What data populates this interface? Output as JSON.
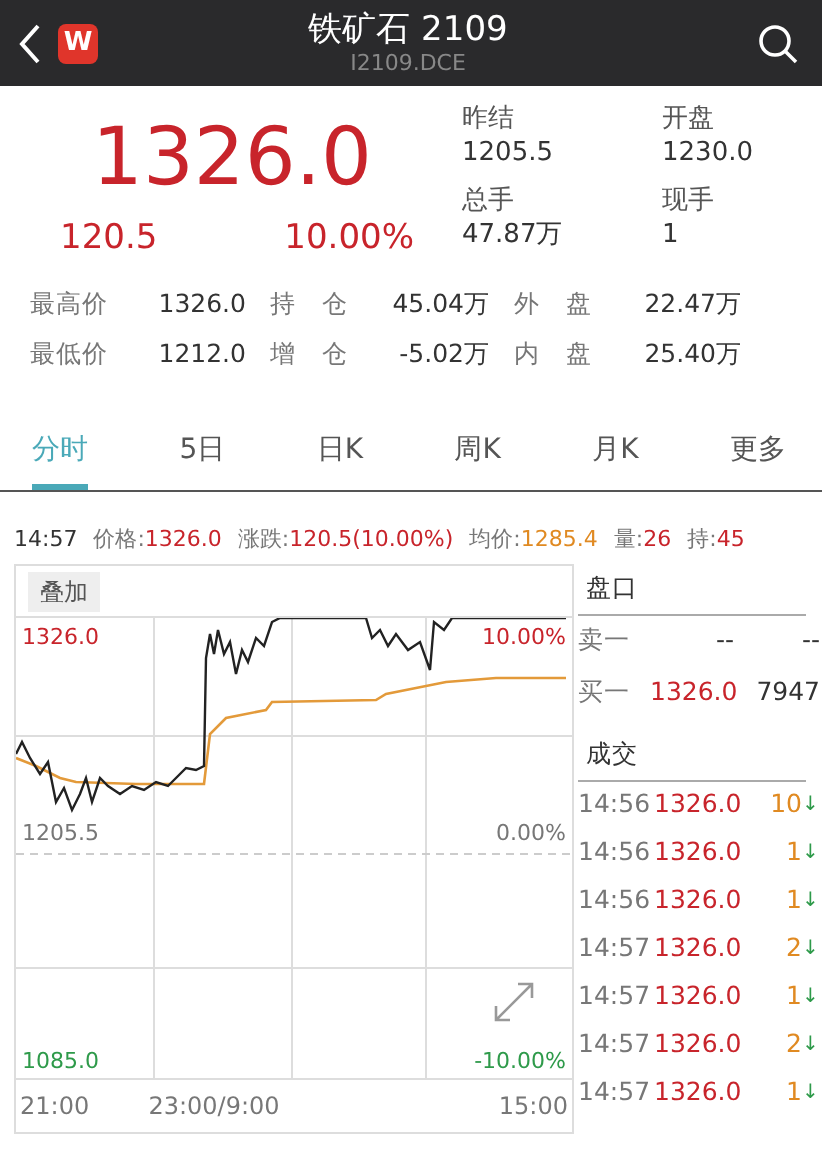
{
  "header": {
    "title": "铁矿石 2109",
    "code": "I2109.DCE",
    "logo": "W"
  },
  "quote": {
    "price": "1326.0",
    "change": "120.5",
    "percent": "10.00%"
  },
  "summary": [
    {
      "label": "昨结",
      "value": "1205.5"
    },
    {
      "label": "开盘",
      "value": "1230.0"
    },
    {
      "label": "总手",
      "value": "47.87万"
    },
    {
      "label": "现手",
      "value": "1"
    }
  ],
  "stats": [
    [
      {
        "label": "最高价",
        "value": "1326.0"
      },
      {
        "label": "持　仓",
        "value": "45.04万"
      },
      {
        "label": "外　盘",
        "value": "22.47万"
      }
    ],
    [
      {
        "label": "最低价",
        "value": "1212.0"
      },
      {
        "label": "增　仓",
        "value": "-5.02万"
      },
      {
        "label": "内　盘",
        "value": "25.40万"
      }
    ]
  ],
  "tabs": [
    {
      "label": "分时",
      "selected": true
    },
    {
      "label": "5日",
      "selected": false
    },
    {
      "label": "日K",
      "selected": false
    },
    {
      "label": "周K",
      "selected": false
    },
    {
      "label": "月K",
      "selected": false
    },
    {
      "label": "更多",
      "selected": false
    }
  ],
  "info_time": "14:57",
  "info_bar": [
    {
      "label": "价格:",
      "value": "1326.0"
    },
    {
      "label": "涨跌:",
      "value": "120.5(10.00%)"
    },
    {
      "label": "均价:",
      "value": "1285.4"
    },
    {
      "label": "量:",
      "value": "26"
    },
    {
      "label": "持:",
      "value": "45"
    }
  ],
  "chart": {
    "overlay_button": "叠加",
    "price_high": "1326.0",
    "pct_high": "10.00%",
    "price_mid": "1205.5",
    "pct_mid": "0.00%",
    "price_low": "1085.0",
    "pct_low": "-10.00%",
    "times": [
      "21:00",
      "23:00/9:00",
      "15:00"
    ]
  },
  "order_book": {
    "title": "盘口",
    "rows": [
      {
        "label": "卖一",
        "price": "--",
        "volume": "--",
        "color": "#333333"
      },
      {
        "label": "买一",
        "price": "1326.0",
        "volume": "7947",
        "color": "#c8242b"
      }
    ]
  },
  "trades": {
    "title": "成交",
    "rows": [
      {
        "time": "14:56",
        "price": "1326.0",
        "volume": "10",
        "arrow": "↓"
      },
      {
        "time": "14:56",
        "price": "1326.0",
        "volume": "1",
        "arrow": "↓"
      },
      {
        "time": "14:56",
        "price": "1326.0",
        "volume": "1",
        "arrow": "↓"
      },
      {
        "time": "14:57",
        "price": "1326.0",
        "volume": "2",
        "arrow": "↓"
      },
      {
        "time": "14:57",
        "price": "1326.0",
        "volume": "1",
        "arrow": "↓"
      },
      {
        "time": "14:57",
        "price": "1326.0",
        "volume": "2",
        "arrow": "↓"
      },
      {
        "time": "14:57",
        "price": "1326.0",
        "volume": "1",
        "arrow": "↓"
      }
    ]
  }
}
